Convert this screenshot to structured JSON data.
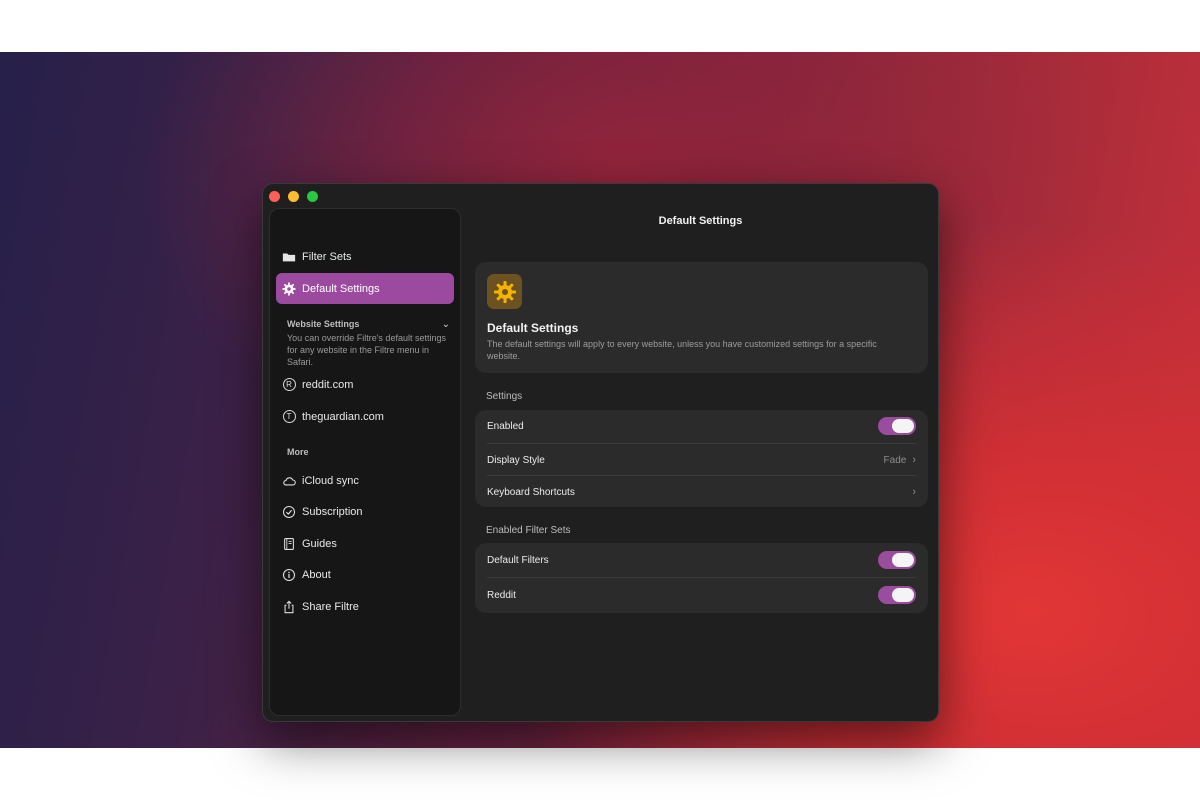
{
  "window": {
    "title": "Default Settings"
  },
  "sidebar": {
    "items": [
      {
        "label": "Filter Sets",
        "icon": "folder-icon"
      },
      {
        "label": "Default Settings",
        "icon": "gear-icon",
        "active": true
      }
    ],
    "website_settings": {
      "label": "Website Settings",
      "description": "You can override Filtre's default settings for any website in the Filtre menu in Safari.",
      "sites": [
        {
          "label": "reddit.com",
          "icon_letter": "R"
        },
        {
          "label": "theguardian.com",
          "icon_letter": "T"
        }
      ]
    },
    "more": {
      "label": "More",
      "items": [
        {
          "label": "iCloud sync",
          "icon": "cloud-icon"
        },
        {
          "label": "Subscription",
          "icon": "checkmark-circle-icon"
        },
        {
          "label": "Guides",
          "icon": "book-icon"
        },
        {
          "label": "About",
          "icon": "info-icon"
        },
        {
          "label": "Share Filtre",
          "icon": "share-icon"
        }
      ]
    }
  },
  "hero": {
    "title": "Default Settings",
    "description": "The default settings will apply to every website, unless you have customized settings for a specific website."
  },
  "settings_group": {
    "label": "Settings",
    "rows": {
      "enabled": {
        "label": "Enabled",
        "on": true
      },
      "display_style": {
        "label": "Display Style",
        "value": "Fade"
      },
      "keyboard_shortcuts": {
        "label": "Keyboard Shortcuts"
      }
    }
  },
  "filter_sets_group": {
    "label": "Enabled Filter Sets",
    "rows": {
      "default_filters": {
        "label": "Default Filters",
        "on": true
      },
      "reddit": {
        "label": "Reddit",
        "on": true
      }
    }
  },
  "colors": {
    "accent": "#9c4a9f",
    "window_bg": "#1f1f1f",
    "card_bg": "#2b2b2b",
    "gear_icon": "#f5b400"
  }
}
